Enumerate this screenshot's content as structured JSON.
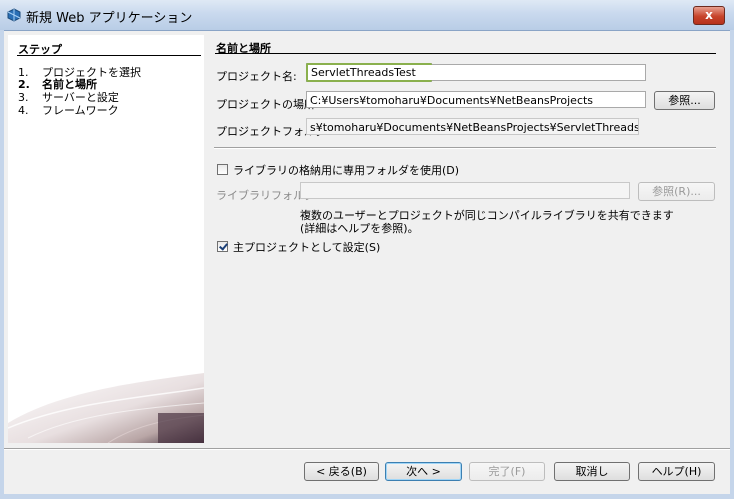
{
  "window": {
    "title": "新規 Web アプリケーション",
    "close_label": "x"
  },
  "steps": {
    "title": "ステップ",
    "items": [
      {
        "num": "1.",
        "label": "プロジェクトを選択"
      },
      {
        "num": "2.",
        "label": "名前と場所"
      },
      {
        "num": "3.",
        "label": "サーバーと設定"
      },
      {
        "num": "4.",
        "label": "フレームワーク"
      }
    ],
    "current_index": 1
  },
  "form": {
    "section_title": "名前と場所",
    "project_name_label": "プロジェクト名:",
    "project_name_value": "ServletThreadsTest",
    "project_location_label": "プロジェクトの場所:",
    "project_location_value": "C:¥Users¥tomoharu¥Documents¥NetBeansProjects",
    "browse_label": "参照...",
    "project_folder_label": "プロジェクトフォルダ:",
    "project_folder_value": "s¥tomoharu¥Documents¥NetBeansProjects¥ServletThreadsTest",
    "use_lib_folder_label": "ライブラリの格納用に専用フォルダを使用(D)",
    "use_lib_folder_checked": false,
    "lib_folder_label": "ライブラリフォルダ:",
    "lib_folder_value": "",
    "lib_browse_label": "参照(R)...",
    "info_line1": "複数のユーザーとプロジェクトが同じコンパイルライブラリを共有できます",
    "info_line2": "(詳細はヘルプを参照)。",
    "main_project_label": "主プロジェクトとして設定(S)",
    "main_project_checked": true
  },
  "footer": {
    "back_label": "< 戻る(B)",
    "next_label": "次へ >",
    "finish_label": "完了(F)",
    "cancel_label": "取消し",
    "help_label": "ヘルプ(H)"
  },
  "colors": {
    "titlebar": "#c9d9ee",
    "close_button": "#c7442b",
    "focus_border": "#8ab04d"
  }
}
